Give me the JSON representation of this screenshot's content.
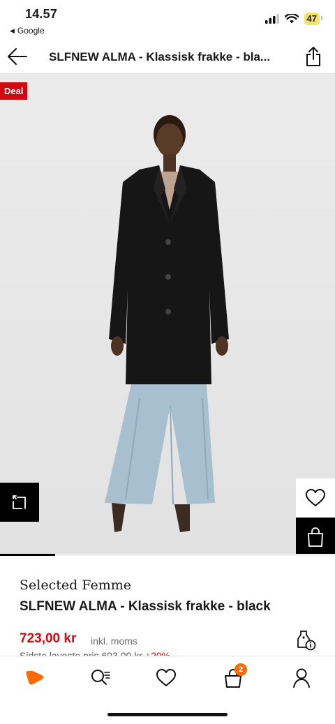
{
  "status_bar": {
    "time": "14.57",
    "back_app": "Google",
    "battery": "47"
  },
  "nav": {
    "title": "SLFNEW ALMA - Klassisk frakke - bla..."
  },
  "hero": {
    "deal_label": "Deal",
    "gallery_progress": 0.165
  },
  "product": {
    "brand": "Selected Femme",
    "name": "SLFNEW ALMA - Klassisk frakke - black",
    "price": "723,00 kr",
    "vat_note": "inkl. moms",
    "lowest_price_label": "Sidste laveste pris",
    "lowest_price_value": "603,00 kr",
    "lowest_price_change": "+20%"
  },
  "tab_bar": {
    "cart_count": "2"
  },
  "colors": {
    "brand_orange": "#ff6900",
    "deal_red": "#d10a11"
  },
  "icons": [
    "arrow-left-icon",
    "share-icon",
    "compare-icon",
    "heart-icon",
    "shopping-bag-icon",
    "price-tag-info-icon",
    "zalando-logo-icon",
    "search-icon",
    "heart-icon",
    "bag-icon",
    "user-icon"
  ]
}
